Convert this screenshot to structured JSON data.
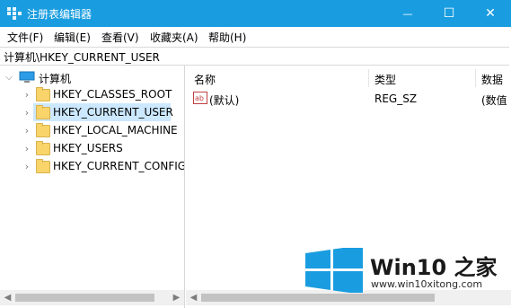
{
  "window": {
    "title": "注册表编辑器",
    "minimize_glyph": "—",
    "maximize_glyph": "☐",
    "close_glyph": "✕",
    "accent_color": "#1a9de0"
  },
  "menu": {
    "items": [
      "文件(F)",
      "编辑(E)",
      "查看(V)",
      "收藏夹(A)",
      "帮助(H)"
    ]
  },
  "address": {
    "path": "计算机\\HKEY_CURRENT_USER"
  },
  "tree": {
    "root": {
      "label": "计算机",
      "icon": "computer-icon",
      "expanded": true
    },
    "keys": [
      {
        "label": "HKEY_CLASSES_ROOT",
        "selected": false
      },
      {
        "label": "HKEY_CURRENT_USER",
        "selected": true
      },
      {
        "label": "HKEY_LOCAL_MACHINE",
        "selected": false
      },
      {
        "label": "HKEY_USERS",
        "selected": false
      },
      {
        "label": "HKEY_CURRENT_CONFIG",
        "selected": false
      }
    ]
  },
  "values": {
    "columns": [
      "名称",
      "类型",
      "数据"
    ],
    "rows": [
      {
        "name": "(默认)",
        "type": "REG_SZ",
        "data": "(数值",
        "icon": "string-value-icon"
      }
    ]
  },
  "watermark": {
    "title": "Win10 之家",
    "url": "www.win10xitong.com",
    "logo_color": "#1a9de0"
  }
}
